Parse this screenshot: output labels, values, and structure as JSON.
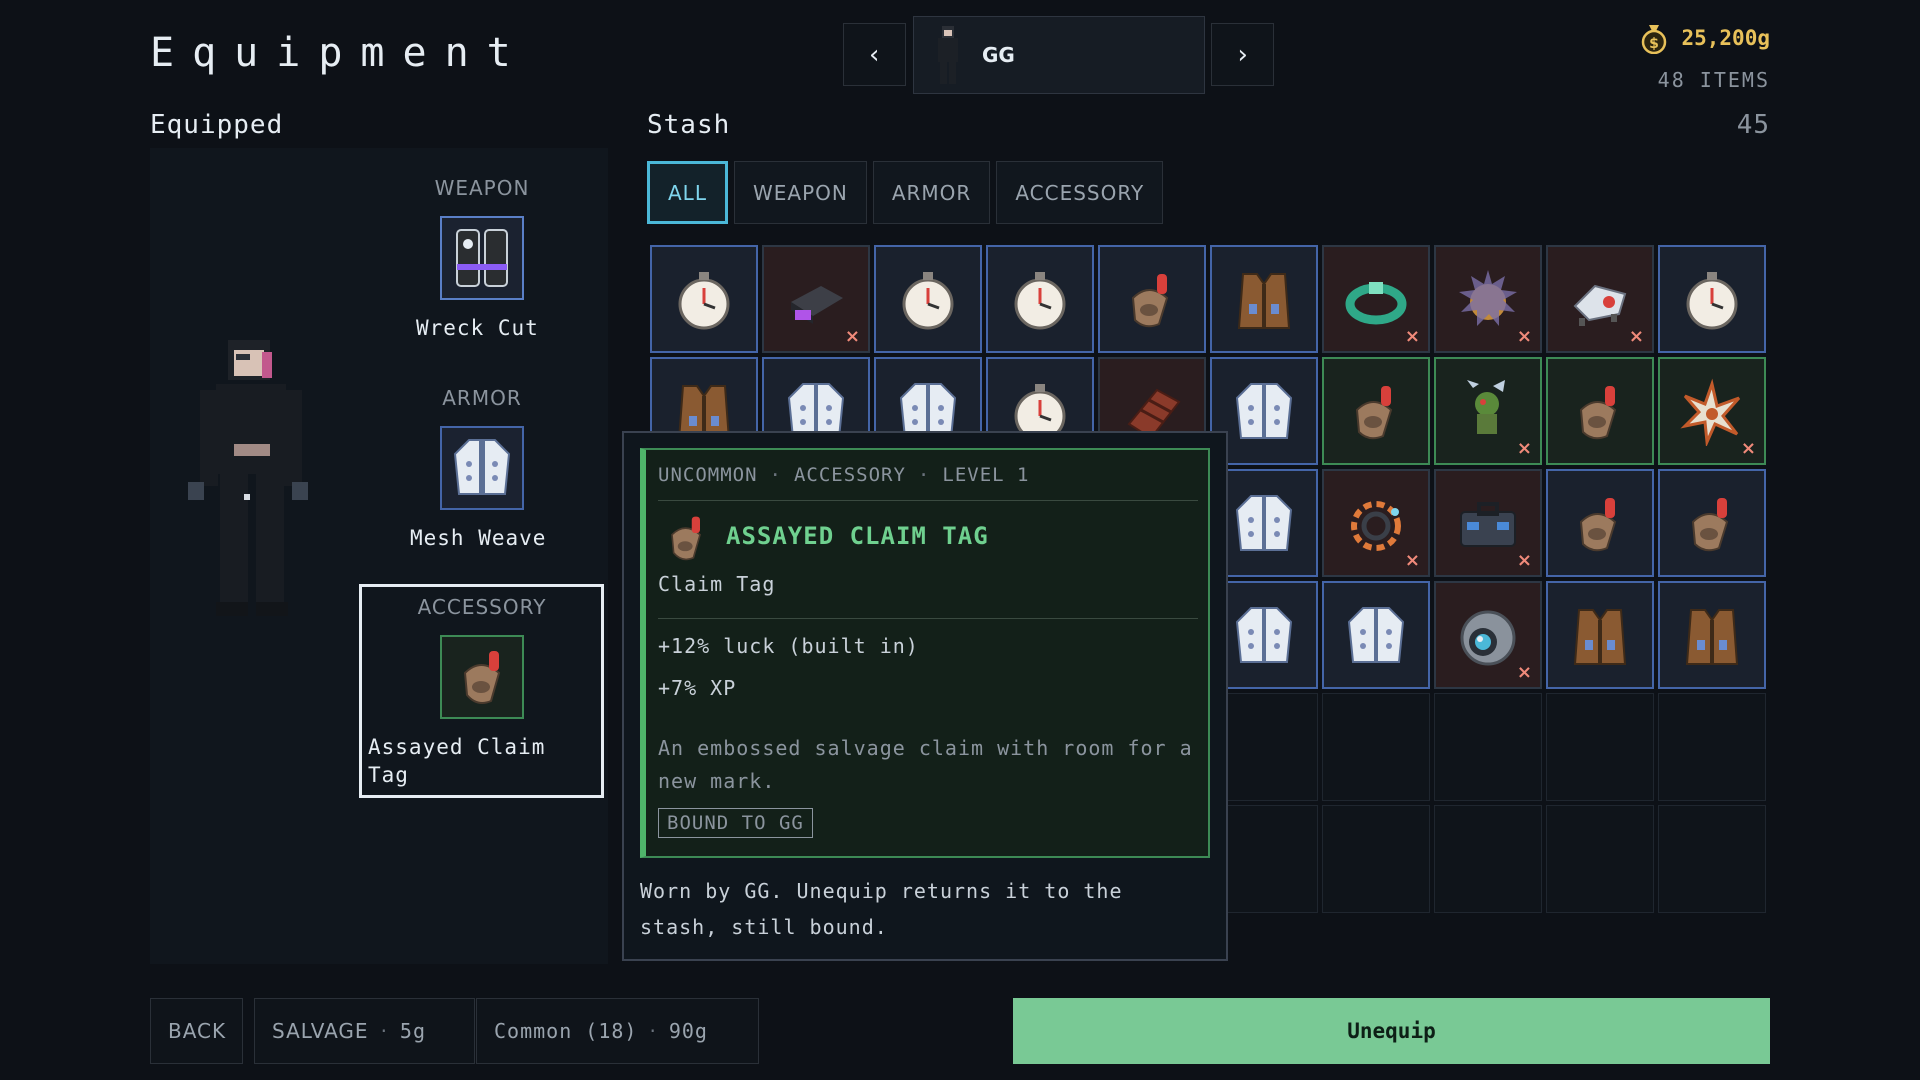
{
  "header": {
    "title": "Equipment",
    "character": "GG",
    "gold": "25,200g",
    "items_count": "48 ITEMS"
  },
  "equipped": {
    "heading": "Equipped",
    "slots": [
      {
        "label": "WEAPON",
        "name": "Wreck Cut"
      },
      {
        "label": "ARMOR",
        "name": "Mesh Weave"
      },
      {
        "label": "ACCESSORY",
        "name": "Assayed Claim Tag"
      }
    ]
  },
  "stash": {
    "heading": "Stash",
    "count": "45",
    "tabs": [
      "ALL",
      "WEAPON",
      "ARMOR",
      "ACCESSORY"
    ],
    "active_tab": "ALL",
    "grid": [
      {
        "icon": "stopwatch",
        "rarity": "common",
        "x": false
      },
      {
        "icon": "chip",
        "rarity": "rare",
        "x": true
      },
      {
        "icon": "stopwatch",
        "rarity": "common",
        "x": false
      },
      {
        "icon": "stopwatch",
        "rarity": "common",
        "x": false
      },
      {
        "icon": "claim-tag",
        "rarity": "common",
        "x": false
      },
      {
        "icon": "vest",
        "rarity": "common",
        "x": false
      },
      {
        "icon": "ring",
        "rarity": "rare",
        "x": true
      },
      {
        "icon": "spiky-orb",
        "rarity": "rare",
        "x": true
      },
      {
        "icon": "drone",
        "rarity": "rare",
        "x": true
      },
      {
        "icon": "stopwatch",
        "rarity": "common",
        "x": false
      },
      {
        "icon": "vest",
        "rarity": "common",
        "x": false
      },
      {
        "icon": "jacket",
        "rarity": "common",
        "x": false
      },
      {
        "icon": "jacket",
        "rarity": "common",
        "x": false
      },
      {
        "icon": "stopwatch",
        "rarity": "common",
        "x": false
      },
      {
        "icon": "gauntlet",
        "rarity": "rare",
        "x": false
      },
      {
        "icon": "jacket",
        "rarity": "common",
        "x": false
      },
      {
        "icon": "claim-tag",
        "rarity": "uncommon",
        "x": false
      },
      {
        "icon": "goblin",
        "rarity": "uncommon",
        "x": true
      },
      {
        "icon": "claim-tag",
        "rarity": "uncommon",
        "x": false
      },
      {
        "icon": "star-burst",
        "rarity": "uncommon",
        "x": true
      },
      {
        "icon": "jacket",
        "rarity": "common",
        "x": false
      },
      {
        "icon": "jacket",
        "rarity": "common",
        "x": false
      },
      {
        "icon": "jacket",
        "rarity": "common",
        "x": false
      },
      {
        "icon": "jacket",
        "rarity": "common",
        "x": false
      },
      {
        "icon": "jacket",
        "rarity": "common",
        "x": false
      },
      {
        "icon": "jacket",
        "rarity": "common",
        "x": false
      },
      {
        "icon": "coil",
        "rarity": "rare",
        "x": true
      },
      {
        "icon": "case",
        "rarity": "rare",
        "x": true
      },
      {
        "icon": "claim-tag",
        "rarity": "common",
        "x": false
      },
      {
        "icon": "claim-tag",
        "rarity": "common",
        "x": false
      },
      {
        "icon": "jacket",
        "rarity": "common",
        "x": false
      },
      {
        "icon": "jacket",
        "rarity": "common",
        "x": false
      },
      {
        "icon": "jacket",
        "rarity": "common",
        "x": false
      },
      {
        "icon": "jacket",
        "rarity": "common",
        "x": false
      },
      {
        "icon": "jacket",
        "rarity": "common",
        "x": false
      },
      {
        "icon": "jacket",
        "rarity": "common",
        "x": false
      },
      {
        "icon": "jacket",
        "rarity": "common",
        "x": false
      },
      {
        "icon": "eye-orb",
        "rarity": "rare",
        "x": true
      },
      {
        "icon": "vest",
        "rarity": "common",
        "x": false
      },
      {
        "icon": "vest",
        "rarity": "common",
        "x": false
      }
    ],
    "empty_slots": 20
  },
  "tooltip": {
    "rarity": "UNCOMMON",
    "type": "ACCESSORY",
    "level": "LEVEL 1",
    "name": "ASSAYED CLAIM TAG",
    "subtype": "Claim Tag",
    "stat1": "+12% luck (built in)",
    "stat2": "+7% XP",
    "flavor": "An embossed salvage claim with room for a new mark.",
    "bound": "BOUND TO GG",
    "note": "Worn by GG. Unequip returns it to the stash, still bound."
  },
  "footer": {
    "back": "BACK",
    "salvage_label": "SALVAGE",
    "salvage_cost": "5g",
    "common_label": "Common (18)",
    "common_cost": "90g",
    "unequip": "Unequip"
  },
  "colors": {
    "accent_tab": "#4bb8d8",
    "uncommon": "#6fd08f",
    "gold": "#e8c15a",
    "unequip_bg": "#79c995"
  }
}
